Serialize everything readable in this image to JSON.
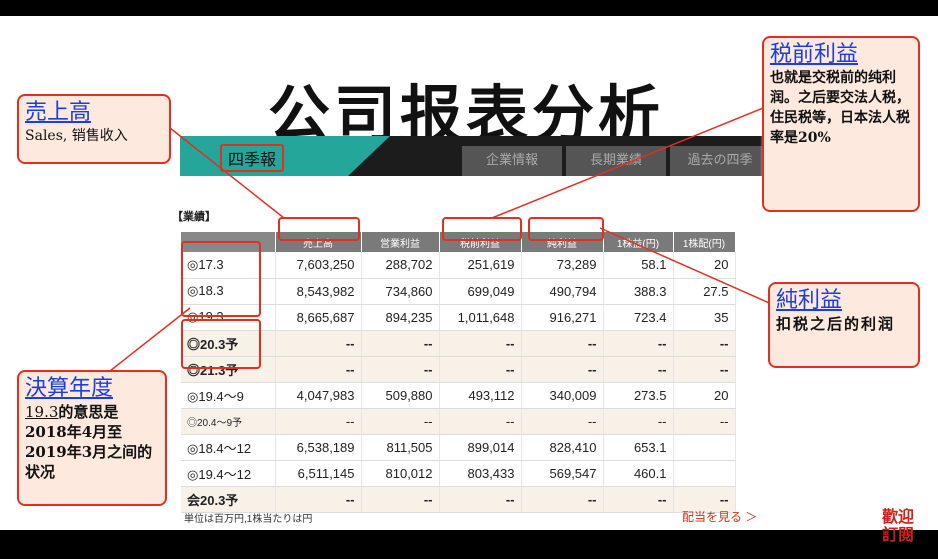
{
  "title": "公司报表分析",
  "nav": {
    "active": "四季報",
    "tabs": [
      "企業情報",
      "長期業績",
      "過去の四季"
    ]
  },
  "section": "【業績】",
  "table": {
    "columns": [
      "",
      "売上高",
      "営業利益",
      "税前利益",
      "純利益",
      "1株益(円)",
      "1株配(円)"
    ],
    "rows": [
      {
        "label": "◎17.3",
        "cells": [
          "7,603,250",
          "288,702",
          "251,619",
          "73,289",
          "58.1",
          "20"
        ]
      },
      {
        "label": "◎18.3",
        "cells": [
          "8,543,982",
          "734,860",
          "699,049",
          "490,794",
          "388.3",
          "27.5"
        ]
      },
      {
        "label": "◎19.3",
        "cells": [
          "8,665,687",
          "894,235",
          "1,011,648",
          "916,271",
          "723.4",
          "35"
        ]
      },
      {
        "label": "◎20.3予",
        "cells": [
          "--",
          "--",
          "--",
          "--",
          "--",
          "--"
        ]
      },
      {
        "label": "◎21.3予",
        "cells": [
          "--",
          "--",
          "--",
          "--",
          "--",
          "--"
        ]
      },
      {
        "label": "◎19.4〜9",
        "cells": [
          "4,047,983",
          "509,880",
          "493,112",
          "340,009",
          "273.5",
          "20"
        ]
      },
      {
        "label": "◎20.4〜9予",
        "cells": [
          "--",
          "--",
          "--",
          "--",
          "--",
          "--"
        ]
      },
      {
        "label": "◎18.4〜12",
        "cells": [
          "6,538,189",
          "811,505",
          "899,014",
          "828,410",
          "653.1",
          ""
        ]
      },
      {
        "label": "◎19.4〜12",
        "cells": [
          "6,511,145",
          "810,012",
          "803,433",
          "569,547",
          "460.1",
          ""
        ]
      },
      {
        "label": "会20.3予",
        "cells": [
          "--",
          "--",
          "--",
          "--",
          "--",
          "--"
        ]
      }
    ]
  },
  "footnote": "単位は百万円,1株当たりは円",
  "more_link": "配当を見る ＞",
  "callouts": {
    "sales": {
      "head": "売上高",
      "body": "Sales, 销售收入"
    },
    "pretax": {
      "head": "税前利益",
      "body": "也就是交税前的纯利润。之后要交法人税，住民税等，日本法人税率是20%"
    },
    "net": {
      "head": "純利益",
      "body": "扣税之后的利润"
    },
    "fiscal": {
      "head": "決算年度",
      "body_u": "19.3",
      "body": "的意思是2018年4月至2019年3月之间的状况"
    }
  },
  "seal": "歡迎訂閱",
  "colors": {
    "accent_red": "#e03020",
    "link_blue": "#1a3fe0",
    "teal": "#25a69a",
    "callout_bg": "#fde9dd"
  }
}
